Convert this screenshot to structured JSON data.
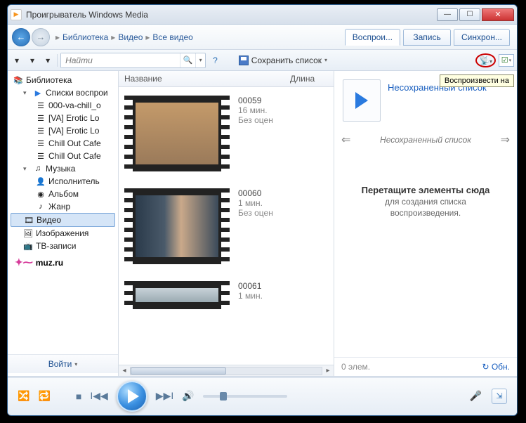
{
  "titlebar": {
    "title": "Проигрыватель Windows Media"
  },
  "breadcrumb": {
    "seg1": "Библиотека",
    "seg2": "Видео",
    "seg3": "Все видео"
  },
  "tabs": {
    "play": "Воспрои...",
    "burn": "Запись",
    "sync": "Синхрон..."
  },
  "toolbar": {
    "search_placeholder": "Найти",
    "save_list": "Сохранить список",
    "tooltip": "Воспроизвести на"
  },
  "columns": {
    "name": "Название",
    "length": "Длина"
  },
  "tree": {
    "library": "Библиотека",
    "playlists": "Списки воспрои",
    "pl_items": [
      "000-va-chill_o",
      "[VA] Erotic Lo",
      "[VA] Erotic Lo",
      "Chill Out Cafe",
      "Chill Out Cafe"
    ],
    "music": "Музыка",
    "artist": "Исполнитель",
    "album": "Альбом",
    "genre": "Жанр",
    "video": "Видео",
    "images": "Изображения",
    "tv": "ТВ-записи",
    "muz": "muz.ru"
  },
  "login": "Войти",
  "videos": [
    {
      "id": "00059",
      "dur": "16 мин.",
      "rating": "Без оцен",
      "thumb_bg": "linear-gradient(#b98a5a,#8a6a4a)"
    },
    {
      "id": "00060",
      "dur": "1 мин.",
      "rating": "Без оцен",
      "thumb_bg": "linear-gradient(90deg,#3a4a5a,#6a7a8a 40%,#caa98a 60%,#4a5a6a)"
    },
    {
      "id": "00061",
      "dur": "1 мин.",
      "rating": "",
      "thumb_bg": "linear-gradient(#bac4c8,#8a9aa4)"
    }
  ],
  "playlist": {
    "title": "Несохраненный список",
    "nav_label": "Несохраненный список",
    "drop_h": "Перетащите элементы сюда",
    "drop_s1": "для создания списка",
    "drop_s2": "воспроизведения.",
    "status": "0 элем.",
    "refresh": "Обн."
  }
}
